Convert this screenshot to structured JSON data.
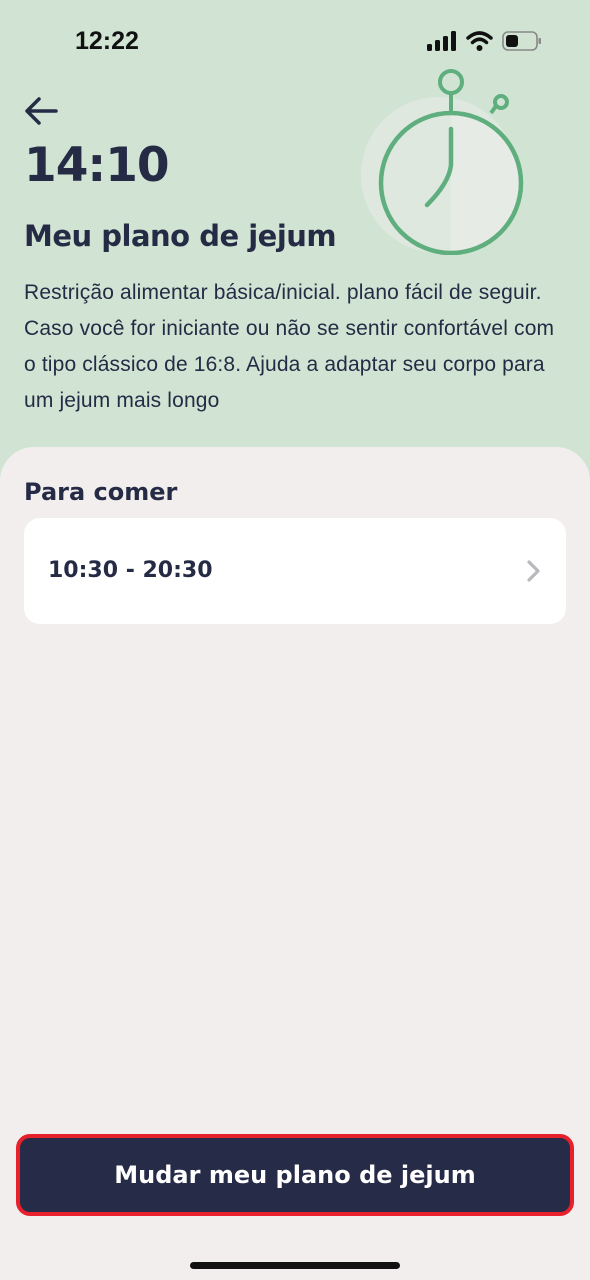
{
  "status_bar": {
    "time": "12:22",
    "icons": [
      "signal-icon",
      "wifi-icon",
      "battery-icon"
    ]
  },
  "header": {
    "back_icon": "arrow-left-icon",
    "fasting_hours": "14:10",
    "title": "Meu plano de jejum",
    "description": "Restrição alimentar básica/inicial. plano fácil de seguir. Caso você for iniciante ou não se sentir confortável com o tipo clássico de 16:8. Ajuda a adaptar seu corpo para um jejum mais longo",
    "illustration": "stopwatch-icon"
  },
  "eating_window": {
    "section_title": "Para comer",
    "time_range": "10:30 - 20:30",
    "chevron_icon": "chevron-right-icon"
  },
  "footer": {
    "change_plan_label": "Mudar meu plano de jejum"
  },
  "colors": {
    "header_bg": "#d1e4d3",
    "sheet_bg": "#f2eeed",
    "primary": "#262b47",
    "accent_green": "#5fae7e",
    "highlight_border": "#e8202c"
  }
}
